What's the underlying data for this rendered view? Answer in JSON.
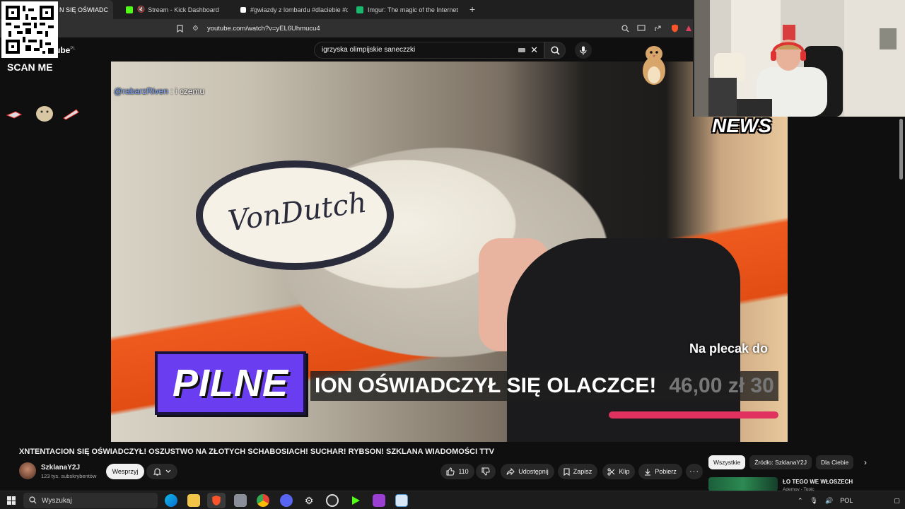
{
  "browser": {
    "tabs": [
      {
        "label": "N SIĘ OŚWIADC",
        "active": true,
        "favicon_color": "#ff0000"
      },
      {
        "label": "Stream - Kick Dashboard",
        "active": false,
        "favicon_color": "#53fc18"
      },
      {
        "label": "#gwiazdy z lombardu #dlaciebie #dc",
        "active": false,
        "favicon_color": "#ffffff"
      },
      {
        "label": "Imgur: The magic of the Internet",
        "active": false,
        "favicon_color": "#1bb76e"
      }
    ],
    "url": "youtube.com/watch?v=yEL6Uhmucu4"
  },
  "youtube": {
    "logo_text": "ube",
    "logo_region": "PL",
    "search_value": "igrzyska olimpijskie saneczzki",
    "video_overlay": {
      "chat_user": "@rabarzRiven",
      "chat_message": " : i czemu",
      "news_badge": "NEWS",
      "side_text": "Na plecak do",
      "banner_label": "PILNE",
      "ticker_text": "ION OŚWIADCZYŁ SIĘ OLACZCE!",
      "ticker_price": "46,00 zł   30"
    },
    "video_title": "XNTENTACION SIĘ OŚWIADCZYŁ! OSZUSTWO NA ZŁOTYCH SCHABOSIACH! SUCHAR! RYBSON! SZKLANA WIADOMOŚCI TTV",
    "channel": {
      "name": "SzklanaY2J",
      "subscribers": "123 tys. subskrybentów",
      "support_label": "Wesprzyj"
    },
    "actions": {
      "like_count": "110",
      "share_label": "Udostępnij",
      "save_label": "Zapisz",
      "clip_label": "Klip",
      "download_label": "Pobierz"
    },
    "filter_chips": [
      "Wszystkie",
      "Źródło: SzklanaY2J",
      "Dla Ciebie"
    ],
    "recommendation": {
      "title": "ŁO TEGO WE WŁOSZECH",
      "subtitle": "Ademov - Topic"
    }
  },
  "overlays": {
    "scan_label": "SCAN ME"
  },
  "taskbar": {
    "search_placeholder": "Wyszukaj",
    "language": "POL"
  },
  "colors": {
    "pilne_purple": "#6a3df0",
    "ticker_accent": "#e0315f",
    "yt_background": "#0f0f0f"
  }
}
